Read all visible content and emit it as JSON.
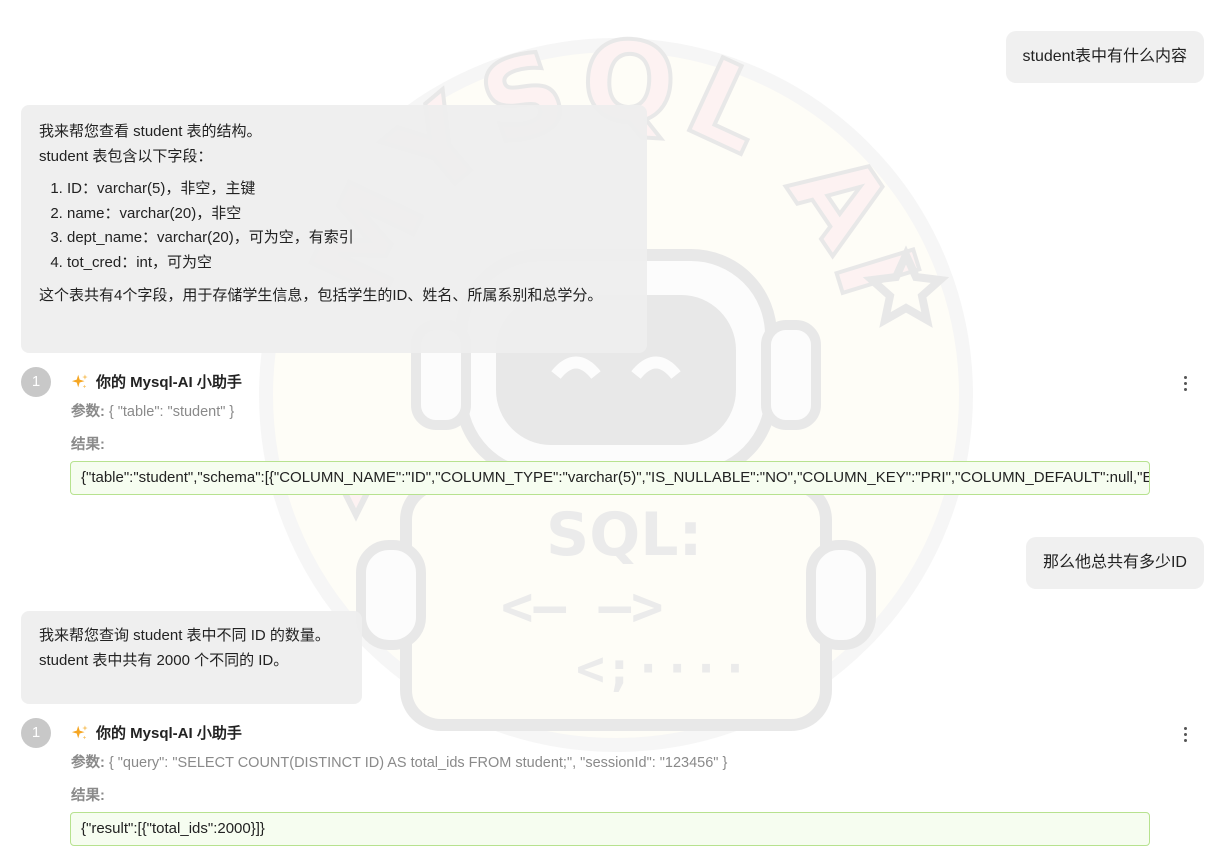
{
  "conversation": {
    "user_message_1": "student表中有什么内容",
    "ai_message_1": {
      "intro": "我来帮您查看 student 表的结构。",
      "summary_line": "student 表包含以下字段：",
      "fields": [
        "ID：varchar(5)，非空，主键",
        "name：varchar(20)，非空",
        "dept_name：varchar(20)，可为空，有索引",
        "tot_cred：int，可为空"
      ],
      "conclusion": "这个表共有4个字段，用于存储学生信息，包括学生的ID、姓名、所属系别和总学分。"
    },
    "tool_call_1": {
      "step": "1",
      "title": "你的 Mysql-AI 小助手",
      "params_label": "参数:",
      "params_value": "{ \"table\": \"student\" }",
      "result_label": "结果:",
      "result_value": "{\"table\":\"student\",\"schema\":[{\"COLUMN_NAME\":\"ID\",\"COLUMN_TYPE\":\"varchar(5)\",\"IS_NULLABLE\":\"NO\",\"COLUMN_KEY\":\"PRI\",\"COLUMN_DEFAULT\":null,\"EXTRA\":\"\"}"
    },
    "user_message_2": "那么他总共有多少ID",
    "ai_message_2": {
      "line1": "我来帮您查询 student 表中不同 ID 的数量。",
      "line2": "student 表中共有 2000 个不同的 ID。"
    },
    "tool_call_2": {
      "step": "1",
      "title": "你的 Mysql-AI 小助手",
      "params_label": "参数:",
      "params_value": "{ \"query\": \"SELECT COUNT(DISTINCT ID) AS total_ids FROM student;\", \"sessionId\": \"123456\" }",
      "result_label": "结果:",
      "result_value": "{\"result\":[{\"total_ids\":2000}]}"
    }
  },
  "icons": {
    "sparkle": "sparkle-icon",
    "more": "more-vertical-icon",
    "watermark": "mysql-ai-robot-watermark"
  },
  "watermark": {
    "arc_text": "MYSQL AI",
    "screen_title": "SQL:",
    "screen_line1": "<— —>",
    "screen_line2": "<;····"
  },
  "colors": {
    "bubble_bg": "#f0f0f0",
    "result_bg": "#f6fdf0",
    "result_border": "#b7e28f",
    "step_badge": "#c8c8c8",
    "muted_text": "#8a8a8a"
  }
}
